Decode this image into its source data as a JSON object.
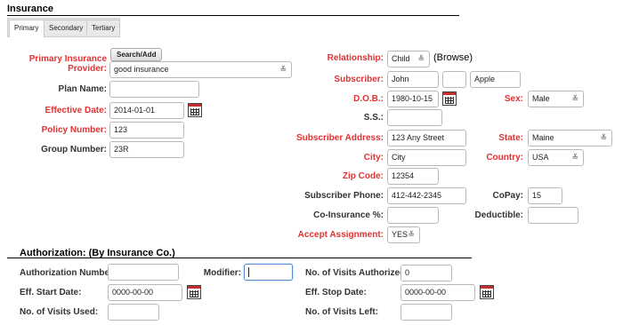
{
  "section_title": "Insurance",
  "tabs": [
    {
      "label": "Primary",
      "active": true
    },
    {
      "label": "Secondary",
      "active": false
    },
    {
      "label": "Tertiary",
      "active": false
    }
  ],
  "left": {
    "provider": {
      "label_1": "Primary Insurance",
      "label_2": "Provider:",
      "button": "Search/Add",
      "value": "good insurance"
    },
    "plan_name": {
      "label": "Plan Name:",
      "value": ""
    },
    "effective_date": {
      "label": "Effective Date:",
      "value": "2014-01-01"
    },
    "policy_number": {
      "label": "Policy Number:",
      "value": "123"
    },
    "group_number": {
      "label": "Group Number:",
      "value": "23R"
    }
  },
  "right": {
    "relationship": {
      "label": "Relationship:",
      "value": "Child",
      "browse": "(Browse)"
    },
    "subscriber": {
      "label": "Subscriber:",
      "first": "John",
      "middle": "",
      "last": "Apple"
    },
    "dob": {
      "label": "D.O.B.:",
      "value": "1980-10-15"
    },
    "sex": {
      "label": "Sex:",
      "value": "Male"
    },
    "ss": {
      "label": "S.S.:",
      "value": ""
    },
    "address": {
      "label": "Subscriber Address:",
      "value": "123 Any Street"
    },
    "state": {
      "label": "State:",
      "value": "Maine"
    },
    "city": {
      "label": "City:",
      "value": "City"
    },
    "country": {
      "label": "Country:",
      "value": "USA"
    },
    "zip": {
      "label": "Zip Code:",
      "value": "12354"
    },
    "phone": {
      "label": "Subscriber Phone:",
      "value": "412-442-2345"
    },
    "copay": {
      "label": "CoPay:",
      "value": "15"
    },
    "coinsurance": {
      "label": "Co-Insurance %:",
      "value": ""
    },
    "deductible": {
      "label": "Deductible:",
      "value": ""
    },
    "accept_assignment": {
      "label": "Accept Assignment:",
      "value": "YES"
    }
  },
  "authorization": {
    "title": "Authorization: (By Insurance Co.)",
    "auth_number": {
      "label": "Authorization Number:",
      "value": ""
    },
    "modifier": {
      "label": "Modifier:",
      "value": ""
    },
    "visits_authorized": {
      "label": "No. of Visits Authorized:",
      "value": "0"
    },
    "eff_start": {
      "label": "Eff. Start Date:",
      "value": "0000-00-00"
    },
    "eff_stop": {
      "label": "Eff. Stop Date:",
      "value": "0000-00-00"
    },
    "visits_used": {
      "label": "No. of Visits Used:",
      "value": ""
    },
    "visits_left": {
      "label": "No. of Visits Left:",
      "value": ""
    }
  },
  "icons": {
    "calendar": "calendar-icon",
    "chevron": "chevron-updown-icon"
  },
  "colors": {
    "required_label": "#e03333",
    "focus_border": "#5a8fd6"
  }
}
